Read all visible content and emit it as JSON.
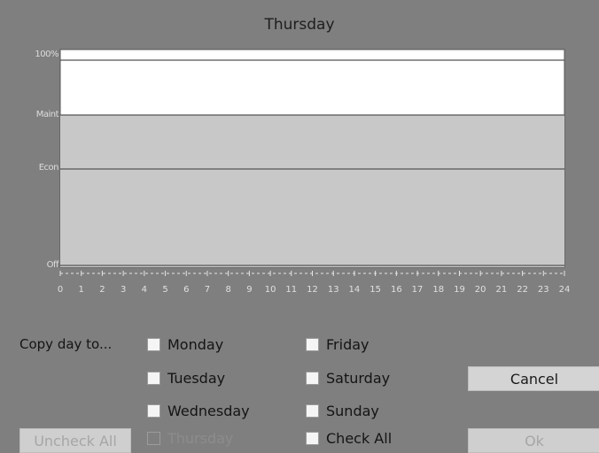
{
  "window": {
    "title": "Thursday"
  },
  "chart_data": {
    "type": "area",
    "x": [
      0,
      24
    ],
    "xlim": [
      0,
      24
    ],
    "xticks": [
      "0",
      "1",
      "2",
      "3",
      "4",
      "5",
      "6",
      "7",
      "8",
      "9",
      "10",
      "11",
      "12",
      "13",
      "14",
      "15",
      "16",
      "17",
      "18",
      "19",
      "20",
      "21",
      "22",
      "23",
      "24"
    ],
    "yticks": [
      "100%",
      "Maint",
      "Econ",
      "Off"
    ],
    "series": [
      {
        "values": [
          "Maint",
          "Maint"
        ]
      }
    ]
  },
  "copy": {
    "label": "Copy day to...",
    "days": [
      {
        "label": "Monday",
        "checked": false,
        "disabled": false
      },
      {
        "label": "Tuesday",
        "checked": false,
        "disabled": false
      },
      {
        "label": "Wednesday",
        "checked": false,
        "disabled": false
      },
      {
        "label": "Thursday",
        "checked": false,
        "disabled": true
      },
      {
        "label": "Friday",
        "checked": false,
        "disabled": false
      },
      {
        "label": "Saturday",
        "checked": false,
        "disabled": false
      },
      {
        "label": "Sunday",
        "checked": false,
        "disabled": false
      },
      {
        "label": "Check All",
        "checked": false,
        "disabled": false
      }
    ]
  },
  "buttons": {
    "uncheck_all": "Uncheck All",
    "cancel": "Cancel",
    "ok": "Ok"
  }
}
